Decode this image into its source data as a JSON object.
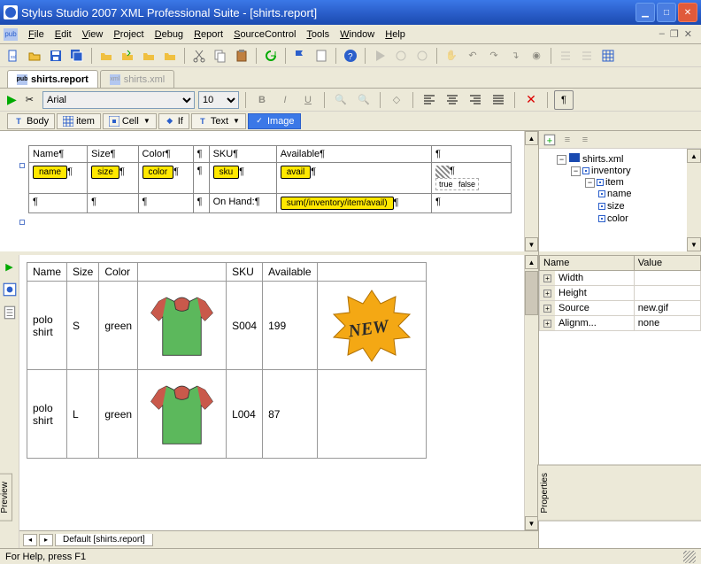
{
  "window": {
    "title": "Stylus Studio 2007 XML Professional Suite - [shirts.report]"
  },
  "menubar": {
    "items": [
      "File",
      "Edit",
      "View",
      "Project",
      "Debug",
      "Report",
      "SourceControl",
      "Tools",
      "Window",
      "Help"
    ]
  },
  "doctabs": [
    {
      "label": "shirts.report",
      "active": true
    },
    {
      "label": "shirts.xml",
      "active": false
    }
  ],
  "format": {
    "font": "Arial",
    "size": "10"
  },
  "typebar": {
    "body": "Body",
    "item": "item",
    "cell": "Cell",
    "if": "If",
    "text": "Text",
    "image": "Image"
  },
  "design": {
    "headers": [
      "Name",
      "Size",
      "Color",
      "",
      "SKU",
      "Available",
      ""
    ],
    "tokens": [
      "name",
      "size",
      "color",
      "",
      "sku",
      "avail",
      ""
    ],
    "truefalse": {
      "t": "true",
      "f": "false"
    },
    "onhand_label": "On Hand:",
    "sum_expr": "sum(/inventory/item/avail)"
  },
  "preview": {
    "headers": [
      "Name",
      "Size",
      "Color",
      "",
      "SKU",
      "Available",
      ""
    ],
    "rows": [
      {
        "name": "polo shirt",
        "size": "S",
        "color": "green",
        "sku": "S004",
        "avail": "199",
        "badge": true
      },
      {
        "name": "polo shirt",
        "size": "L",
        "color": "green",
        "sku": "L004",
        "avail": "87",
        "badge": false
      }
    ],
    "bottom_tab": "Default [shirts.report]",
    "side_tab": "Preview"
  },
  "tree": {
    "root": "shirts.xml",
    "nodes": [
      "inventory",
      "item",
      "name",
      "size",
      "color"
    ]
  },
  "props": {
    "cols": [
      "Name",
      "Value"
    ],
    "rows": [
      {
        "name": "Width",
        "value": ""
      },
      {
        "name": "Height",
        "value": ""
      },
      {
        "name": "Source",
        "value": "new.gif"
      },
      {
        "name": "Alignm...",
        "value": "none"
      }
    ],
    "side_tab": "Properties"
  },
  "statusbar": {
    "text": "For Help, press F1"
  }
}
